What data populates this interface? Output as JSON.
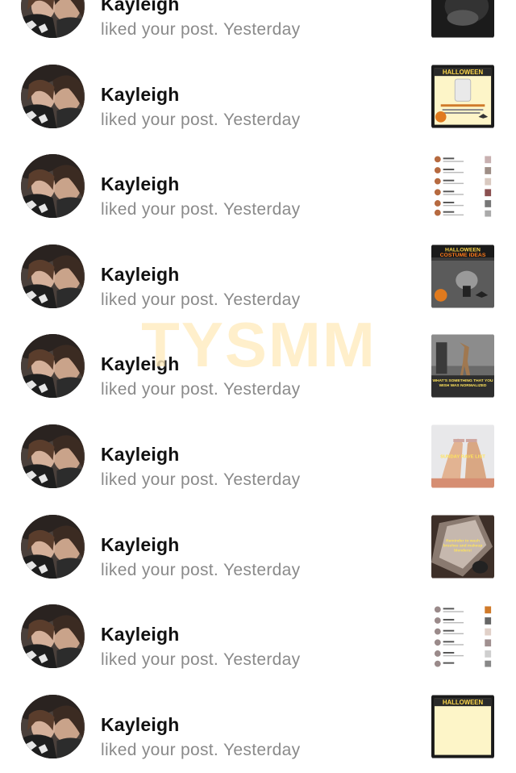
{
  "notifications": [
    {
      "name": "Kayleigh",
      "action": "liked your post.",
      "time": "Yesterday",
      "thumb": "dark"
    },
    {
      "name": "Kayleigh",
      "action": "liked your post.",
      "time": "Yesterday",
      "thumb": "halloween-cup"
    },
    {
      "name": "Kayleigh",
      "action": "liked your post.",
      "time": "Yesterday",
      "thumb": "list"
    },
    {
      "name": "Kayleigh",
      "action": "liked your post.",
      "time": "Yesterday",
      "thumb": "halloween-gym"
    },
    {
      "name": "Kayleigh",
      "action": "liked your post.",
      "time": "Yesterday",
      "thumb": "gym-deer"
    },
    {
      "name": "Kayleigh",
      "action": "liked your post.",
      "time": "Yesterday",
      "thumb": "feet"
    },
    {
      "name": "Kayleigh",
      "action": "liked your post.",
      "time": "Yesterday",
      "thumb": "glass"
    },
    {
      "name": "Kayleigh",
      "action": "liked your post.",
      "time": "Yesterday",
      "thumb": "list2"
    },
    {
      "name": "Kayleigh",
      "action": "liked your post.",
      "time": "Yesterday",
      "thumb": "halloween-partial"
    }
  ],
  "watermark": "TYSMM"
}
